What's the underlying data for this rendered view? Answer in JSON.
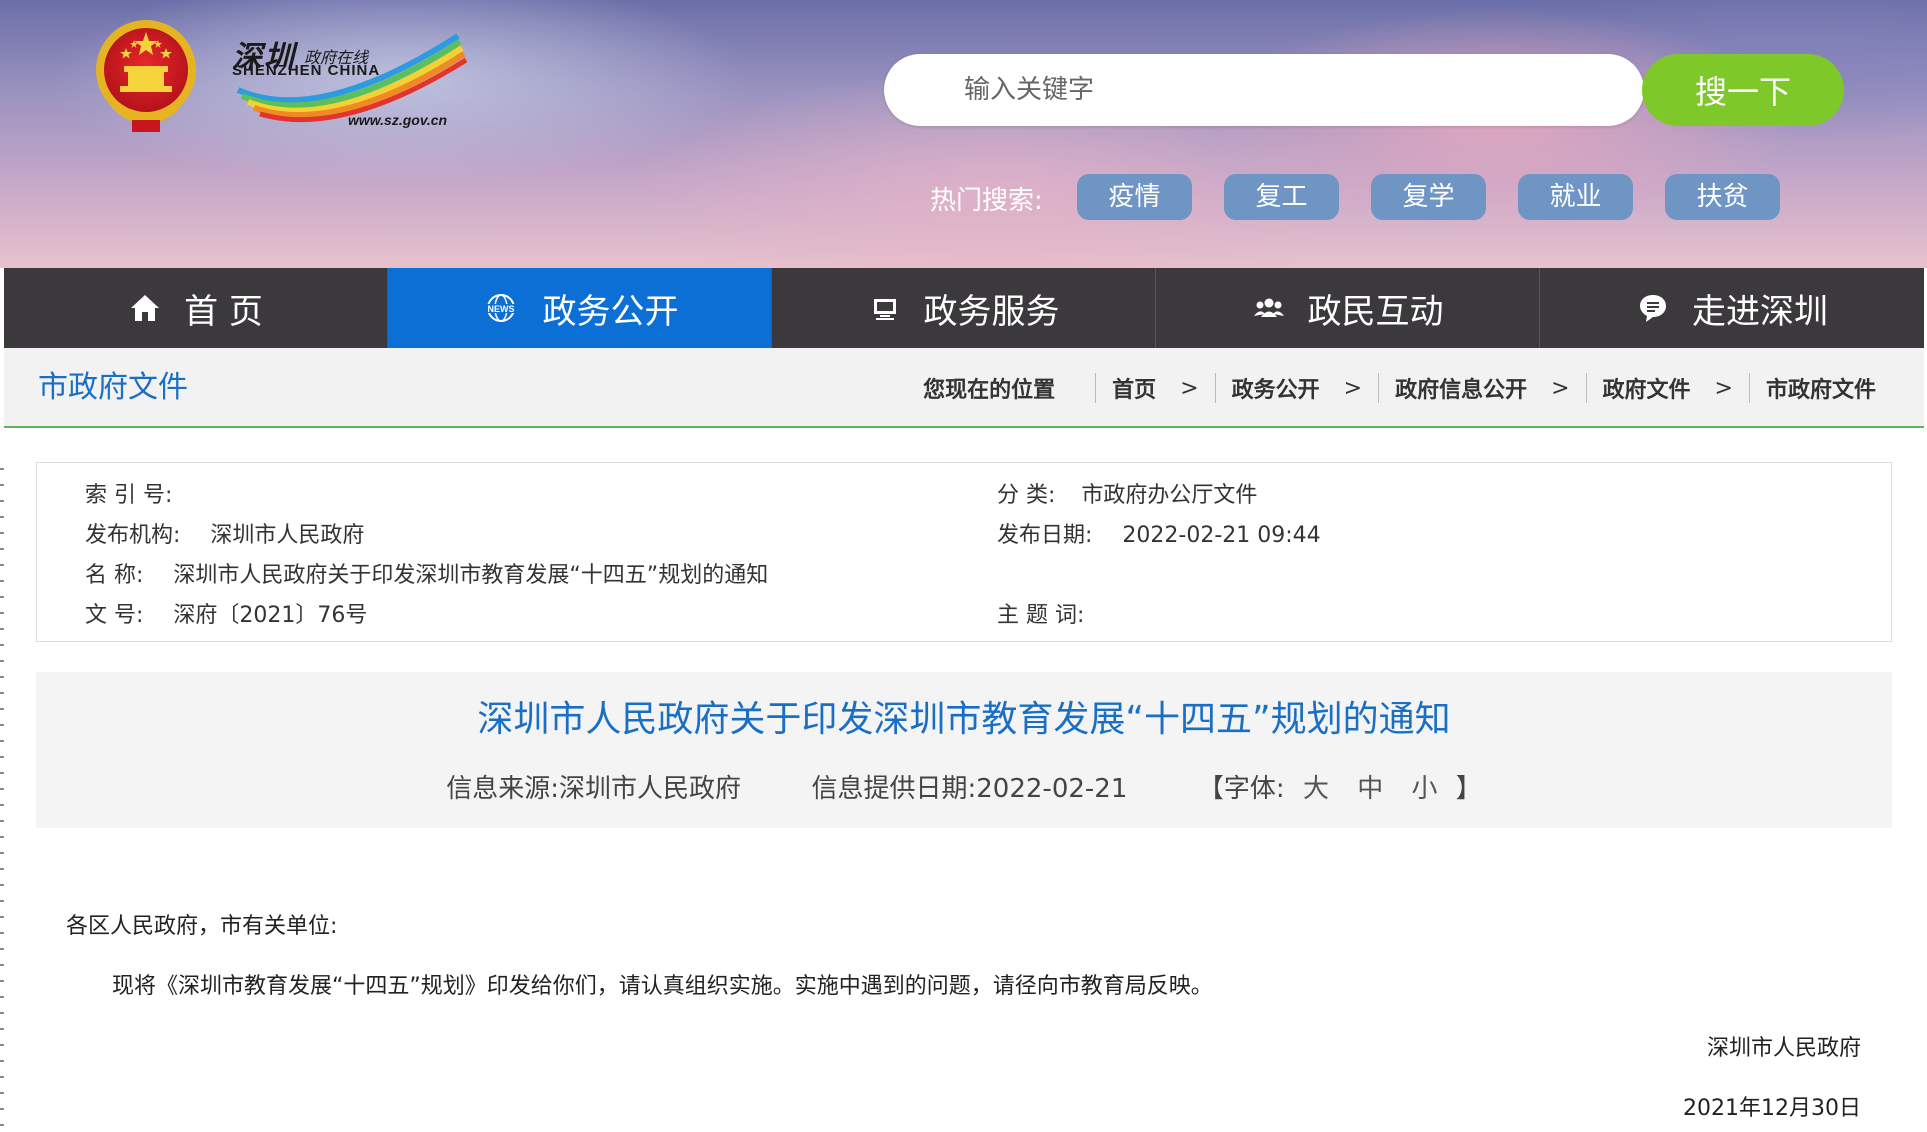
{
  "header": {
    "logo": {
      "text_cn": "深圳",
      "text_cn_small": "政府在线",
      "text_en": "SHENZHEN CHINA",
      "url": "www.sz.gov.cn"
    },
    "search": {
      "placeholder": "输入关键字",
      "button_label": "搜一下"
    },
    "hot_search": {
      "label": "热门搜索:",
      "tags": [
        "疫情",
        "复工",
        "复学",
        "就业",
        "扶贫"
      ]
    }
  },
  "nav": {
    "items": [
      {
        "label": "首 页",
        "icon": "home-icon"
      },
      {
        "label": "政务公开",
        "icon": "news-icon"
      },
      {
        "label": "政务服务",
        "icon": "monitor-icon"
      },
      {
        "label": "政民互动",
        "icon": "people-icon"
      },
      {
        "label": "走进深圳",
        "icon": "chat-bubble-icon"
      }
    ],
    "active_index": 1
  },
  "breadcrumb_bar": {
    "section_title": "市政府文件",
    "here_label": "您现在的位置",
    "items": [
      "首页",
      "政务公开",
      "政府信息公开",
      "政府文件",
      "市政府文件"
    ],
    "separator": ">"
  },
  "info": {
    "index_no": {
      "label": "索 引 号:",
      "value": ""
    },
    "category": {
      "label": "分 类:",
      "value": "市政府办公厅文件"
    },
    "publisher": {
      "label": "发布机构:",
      "value": "深圳市人民政府"
    },
    "publish_date": {
      "label": "发布日期:",
      "value": "2022-02-21 09:44"
    },
    "name": {
      "label": "名 称:",
      "value": "深圳市人民政府关于印发深圳市教育发展“十四五”规划的通知"
    },
    "doc_no": {
      "label": "文 号:",
      "value": "深府〔2021〕76号"
    },
    "keywords": {
      "label": "主 题 词:",
      "value": ""
    }
  },
  "article": {
    "title": "深圳市人民政府关于印发深圳市教育发展“十四五”规划的通知",
    "source_label": "信息来源:",
    "source": "深圳市人民政府",
    "date_label": "信息提供日期:",
    "date": "2022-02-21",
    "font_label_open": "【字体:",
    "font_large": "大",
    "font_medium": "中",
    "font_small": "小",
    "font_label_close": "】",
    "salutation": "各区人民政府，市有关单位:",
    "paragraph": "现将《深圳市教育发展“十四五”规划》印发给你们，请认真组织实施。实施中遇到的问题，请径向市教育局反映。",
    "signature": "深圳市人民政府",
    "sign_date": "2021年12月30日"
  },
  "colors": {
    "nav_bg": "#3b393c",
    "nav_active": "#0c6fd6",
    "search_button": "#7ec82a",
    "hot_tag": "#6e95c4",
    "link_blue": "#1a6fc4",
    "crumb_border": "#5cb85c"
  }
}
